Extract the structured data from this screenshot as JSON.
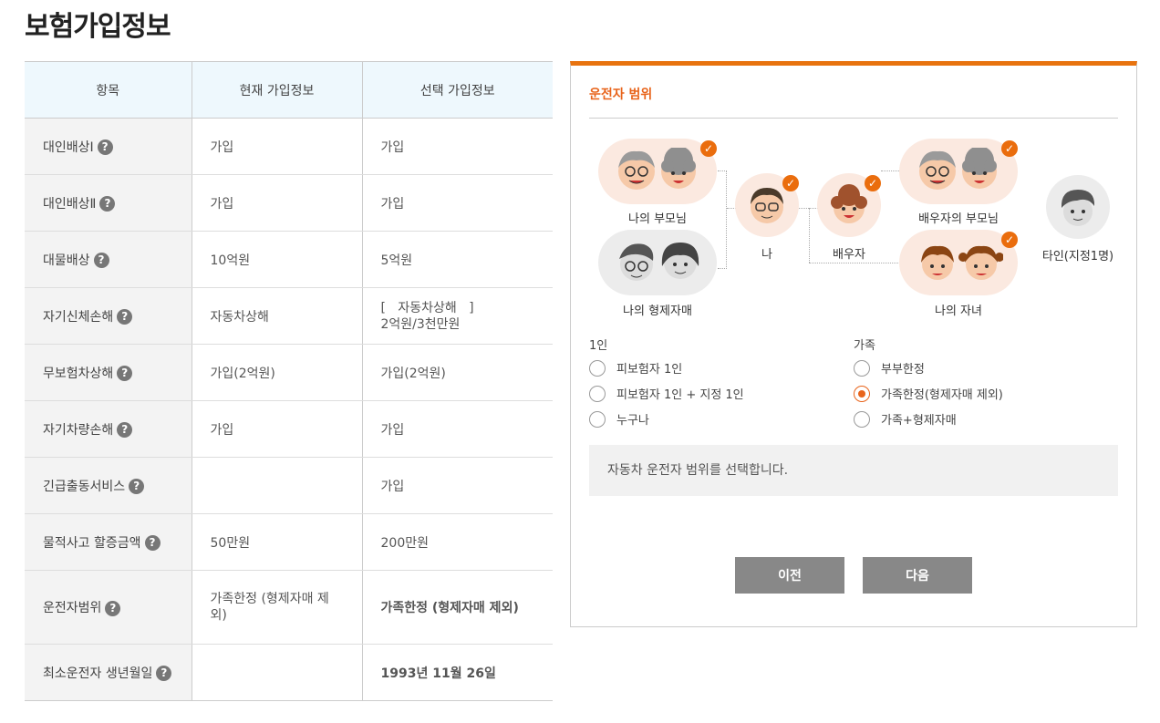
{
  "page": {
    "title": "보험가입정보"
  },
  "table": {
    "headers": [
      "항목",
      "현재 가입정보",
      "선택 가입정보"
    ],
    "rows": [
      {
        "item": "대인배상Ⅰ",
        "current": "가입",
        "selected": "가입"
      },
      {
        "item": "대인배상Ⅱ",
        "current": "가입",
        "selected": "가입"
      },
      {
        "item": "대물배상",
        "current": "10억원",
        "selected": "5억원"
      },
      {
        "item": "자기신체손해",
        "current": "자동차상해",
        "selected_line1": "[   자동차상해   ]",
        "selected_line2": "2억원/3천만원"
      },
      {
        "item": "무보험차상해",
        "current": "가입(2억원)",
        "selected": "가입(2억원)"
      },
      {
        "item": "자기차량손해",
        "current": "가입",
        "selected": "가입"
      },
      {
        "item": "긴급출동서비스",
        "current": "",
        "selected": "가입"
      },
      {
        "item": "물적사고 할증금액",
        "current": "50만원",
        "selected": "200만원"
      },
      {
        "item": "운전자범위",
        "current": "가족한정 (형제자매 제외)",
        "selected": "가족한정 (형제자매 제외)"
      },
      {
        "item": "최소운전자 생년월일",
        "current": "",
        "selected": "1993년 11월 26일"
      }
    ],
    "help_glyph": "?"
  },
  "panel": {
    "title": "운전자 범위",
    "figures": {
      "my_parents": "나의 부모님",
      "my_siblings": "나의 형제자매",
      "me": "나",
      "spouse": "배우자",
      "spouse_parents": "배우자의 부모님",
      "my_children": "나의 자녀",
      "other": "타인(지정1명)"
    },
    "check_glyph": "✓",
    "group_single": {
      "label": "1인",
      "options": [
        "피보험자 1인",
        "피보험자 1인 + 지정 1인",
        "누구나"
      ]
    },
    "group_family": {
      "label": "가족",
      "options": [
        "부부한정",
        "가족한정(형제자매 제외)",
        "가족+형제자매"
      ],
      "selected_index": 1
    },
    "info_text": "자동차 운전자 범위를 선택합니다.",
    "prev_button": "이전",
    "next_button": "다음"
  },
  "colors": {
    "accent": "#e8641b",
    "header_bg": "#eef8fd",
    "button": "#888888"
  }
}
